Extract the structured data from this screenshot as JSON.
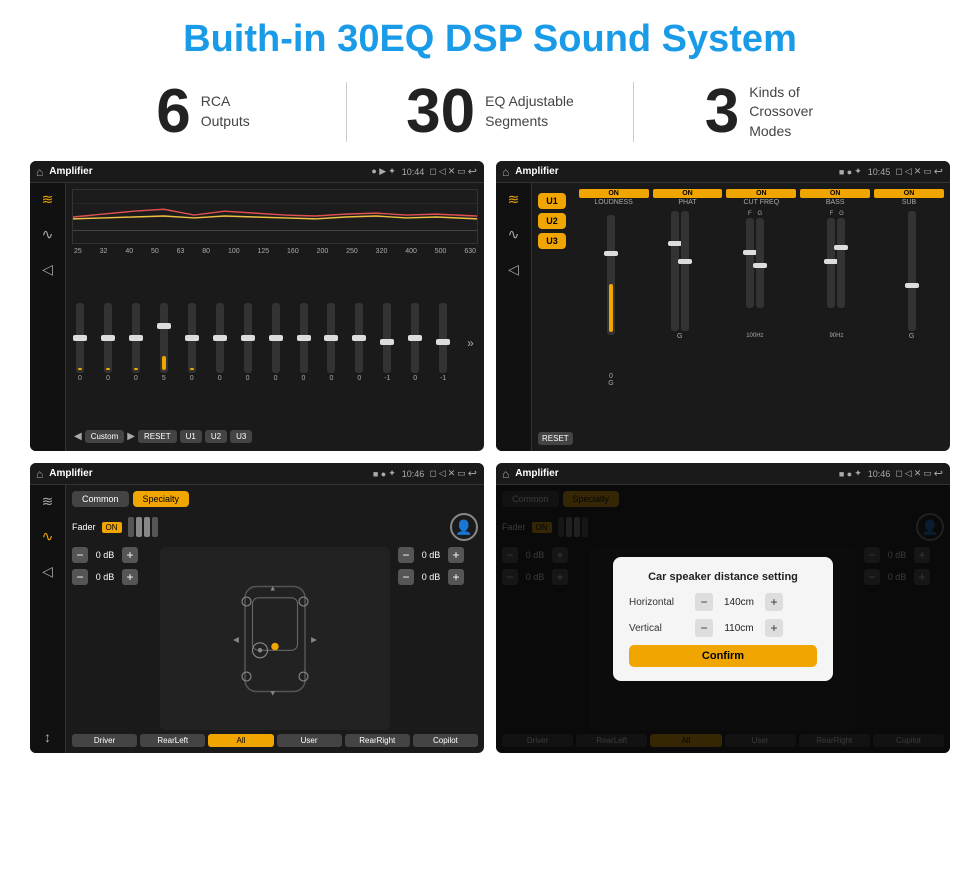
{
  "page": {
    "title": "Buith-in 30EQ DSP Sound System",
    "stats": [
      {
        "number": "6",
        "text_line1": "RCA",
        "text_line2": "Outputs"
      },
      {
        "number": "30",
        "text_line1": "EQ Adjustable",
        "text_line2": "Segments"
      },
      {
        "number": "3",
        "text_line1": "Kinds of",
        "text_line2": "Crossover Modes"
      }
    ]
  },
  "screen1": {
    "title": "Amplifier",
    "time": "10:44",
    "freq_labels": [
      "25",
      "32",
      "40",
      "50",
      "63",
      "80",
      "100",
      "125",
      "160",
      "200",
      "250",
      "320",
      "400",
      "500",
      "630"
    ],
    "slider_values": [
      "0",
      "0",
      "0",
      "5",
      "0",
      "0",
      "0",
      "0",
      "0",
      "0",
      "0",
      "-1",
      "0",
      "-1"
    ],
    "buttons": [
      "Custom",
      "RESET",
      "U1",
      "U2",
      "U3"
    ]
  },
  "screen2": {
    "title": "Amplifier",
    "time": "10:45",
    "presets": [
      "U1",
      "U2",
      "U3"
    ],
    "channels": [
      {
        "label": "LOUDNESS",
        "on": true
      },
      {
        "label": "PHAT",
        "on": true
      },
      {
        "label": "CUT FREQ",
        "on": true
      },
      {
        "label": "BASS",
        "on": true
      },
      {
        "label": "SUB",
        "on": true
      }
    ],
    "reset_label": "RESET"
  },
  "screen3": {
    "title": "Amplifier",
    "time": "10:46",
    "tabs": [
      "Common",
      "Specialty"
    ],
    "fader_label": "Fader",
    "fader_on": "ON",
    "db_values": [
      "0 dB",
      "0 dB",
      "0 dB",
      "0 dB"
    ],
    "buttons": [
      "Driver",
      "RearLeft",
      "All",
      "User",
      "RearRight",
      "Copilot"
    ]
  },
  "screen4": {
    "title": "Amplifier",
    "time": "10:46",
    "tabs": [
      "Common",
      "Specialty"
    ],
    "modal": {
      "title": "Car speaker distance setting",
      "horizontal_label": "Horizontal",
      "horizontal_value": "140cm",
      "vertical_label": "Vertical",
      "vertical_value": "110cm",
      "confirm_label": "Confirm"
    },
    "db_values": [
      "0 dB",
      "0 dB"
    ],
    "buttons": [
      "Driver",
      "RearLeft",
      "All",
      "User",
      "RearRight",
      "Copilot"
    ]
  },
  "icons": {
    "home": "⌂",
    "settings": "⊞",
    "eq": "≋",
    "speaker": "♪",
    "volume": "◁",
    "back": "↩",
    "camera": "◻",
    "sound": "♫",
    "location": "✦",
    "profile": "👤"
  }
}
